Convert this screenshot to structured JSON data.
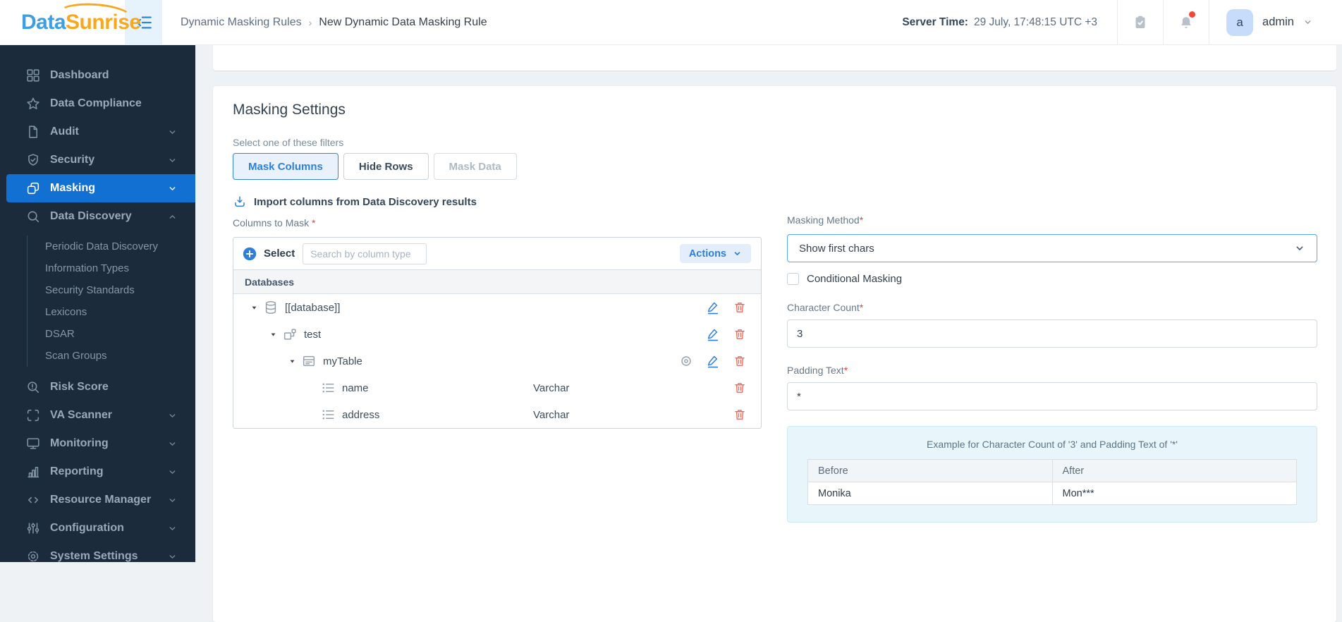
{
  "header": {
    "logo_part1": "Data",
    "logo_part2": "Sunrise",
    "breadcrumb": [
      "Dynamic Masking Rules",
      "New Dynamic Data Masking Rule"
    ],
    "breadcrumb_separator": "›",
    "server_time_label": "Server Time:",
    "server_time_value": "29 July, 17:48:15  UTC +3",
    "user_avatar": "a",
    "user_name": "admin"
  },
  "sidebar": {
    "items": [
      {
        "label": "Dashboard",
        "icon": "dashboard"
      },
      {
        "label": "Data Compliance",
        "icon": "star"
      },
      {
        "label": "Audit",
        "icon": "file",
        "chevron": "down"
      },
      {
        "label": "Security",
        "icon": "shield",
        "chevron": "down"
      },
      {
        "label": "Masking",
        "icon": "mask",
        "chevron": "down",
        "active": true
      },
      {
        "label": "Data Discovery",
        "icon": "search",
        "chevron": "up",
        "children": [
          "Periodic Data Discovery",
          "Information Types",
          "Security Standards",
          "Lexicons",
          "DSAR",
          "Scan Groups"
        ]
      },
      {
        "label": "Risk Score",
        "icon": "risk"
      },
      {
        "label": "VA Scanner",
        "icon": "scan",
        "chevron": "down"
      },
      {
        "label": "Monitoring",
        "icon": "monitor",
        "chevron": "down"
      },
      {
        "label": "Reporting",
        "icon": "chart",
        "chevron": "down"
      },
      {
        "label": "Resource Manager",
        "icon": "code",
        "chevron": "down"
      },
      {
        "label": "Configuration",
        "icon": "sliders",
        "chevron": "down"
      },
      {
        "label": "System Settings",
        "icon": "gear",
        "chevron": "down"
      }
    ]
  },
  "main": {
    "title": "Masking Settings",
    "filter_label": "Select one of these filters",
    "filter_buttons": [
      {
        "label": "Mask Columns",
        "state": "active"
      },
      {
        "label": "Hide Rows",
        "state": "default"
      },
      {
        "label": "Mask Data",
        "state": "disabled"
      }
    ],
    "import_link": "Import columns from Data Discovery results",
    "columns_to_mask": {
      "label": "Columns to Mask",
      "required_mark": "*",
      "select_label": "Select",
      "search_placeholder": "Search by column type",
      "actions_label": "Actions",
      "group_header": "Databases",
      "tree": [
        {
          "name": "[[database]]",
          "type": "database",
          "level": 0,
          "expanded": true,
          "actions": [
            "edit",
            "delete"
          ]
        },
        {
          "name": "test",
          "type": "schema",
          "level": 1,
          "expanded": true,
          "actions": [
            "edit",
            "delete"
          ]
        },
        {
          "name": "myTable",
          "type": "table",
          "level": 2,
          "expanded": true,
          "actions": [
            "view",
            "edit",
            "delete"
          ]
        },
        {
          "name": "name",
          "type": "column",
          "level": 3,
          "datatype": "Varchar",
          "actions": [
            "delete"
          ]
        },
        {
          "name": "address",
          "type": "column",
          "level": 3,
          "datatype": "Varchar",
          "actions": [
            "delete"
          ]
        }
      ]
    },
    "masking_method": {
      "label": "Masking Method",
      "required_mark": "*",
      "value": "Show first chars"
    },
    "conditional_masking": {
      "label": "Conditional Masking",
      "checked": false
    },
    "character_count": {
      "label": "Character Count",
      "required_mark": "*",
      "value": "3"
    },
    "padding_text": {
      "label": "Padding Text",
      "required_mark": "*",
      "value": "*"
    },
    "example": {
      "title": "Example for Character Count of '3' and Padding Text of '*'",
      "columns": [
        "Before",
        "After"
      ],
      "rows": [
        [
          "Monika",
          "Mon***"
        ]
      ]
    }
  },
  "colors": {
    "accent_blue": "#2e7fd9",
    "sidebar_active": "#1170d2",
    "logo_blue": "#3b9fe3",
    "logo_orange": "#f8a81e",
    "danger_red": "#ef675d",
    "notification_dot": "#f4473c"
  }
}
